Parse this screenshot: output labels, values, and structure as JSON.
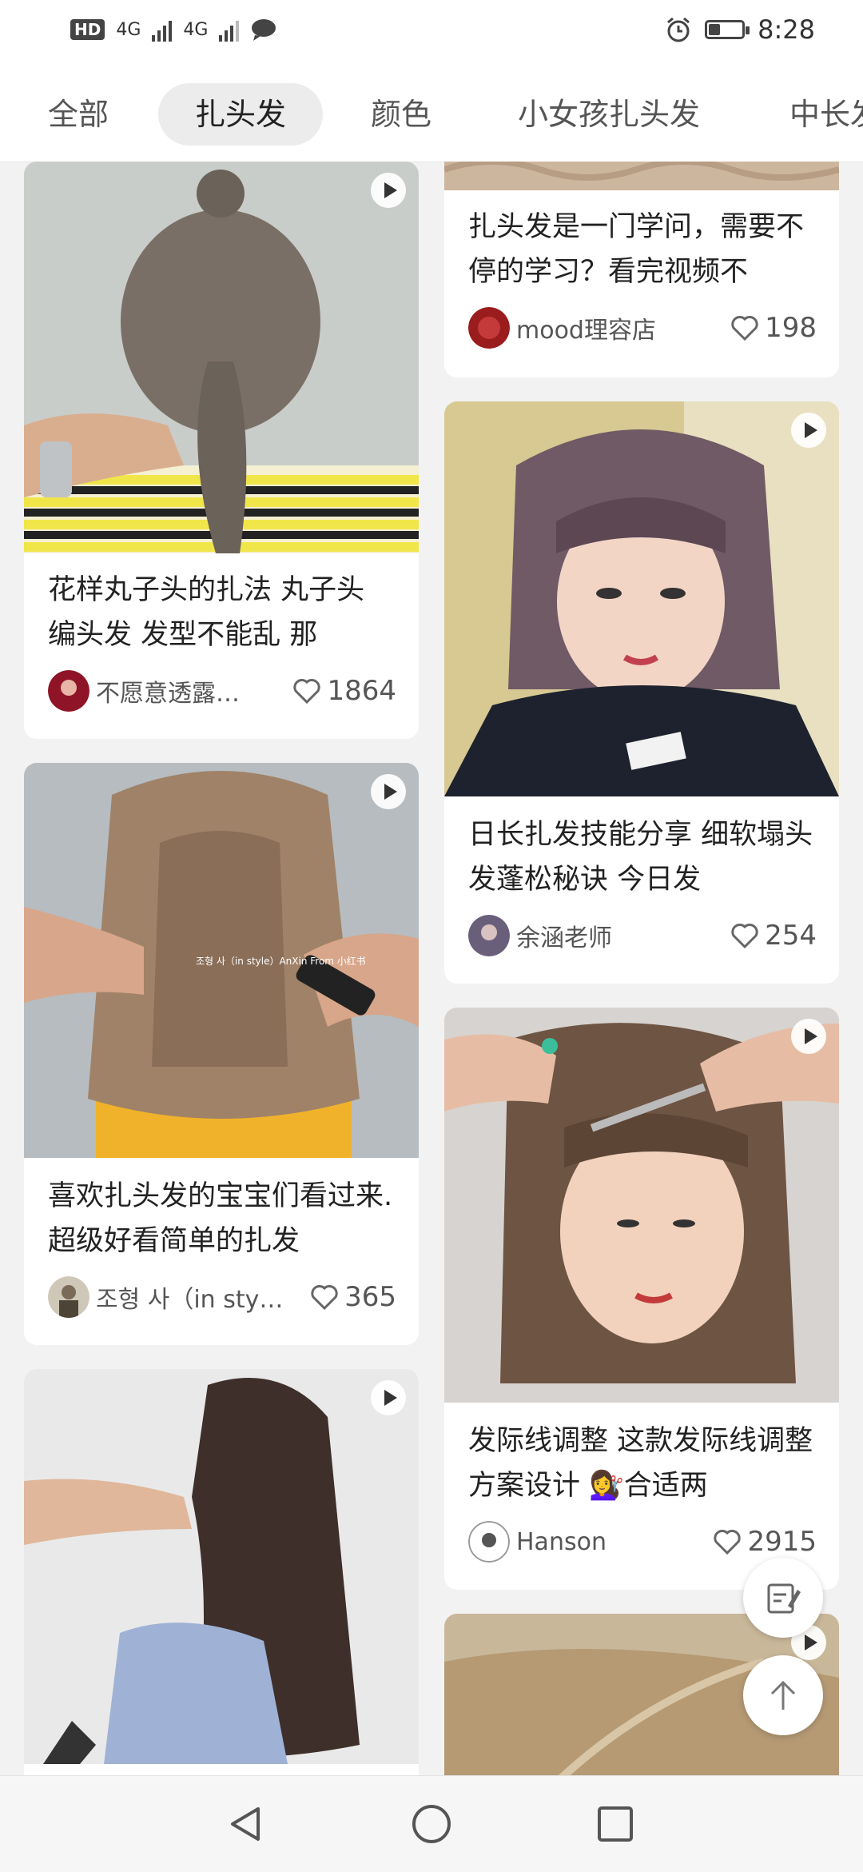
{
  "status_bar": {
    "hd_badge": "HD",
    "sim1": "4G",
    "sim2": "4G",
    "time": "8:28",
    "icons": [
      "signal-icon",
      "message-icon",
      "alarm-icon",
      "battery-icon"
    ],
    "battery_level": 0.35
  },
  "tabs": [
    {
      "label": "全部",
      "active": false
    },
    {
      "label": "扎头发",
      "active": true
    },
    {
      "label": "颜色",
      "active": false
    },
    {
      "label": "小女孩扎头发",
      "active": false
    },
    {
      "label": "中长发",
      "active": false
    }
  ],
  "cards_left": [
    {
      "title": "花样丸子头的扎法 丸子头 编头发 发型不能乱 那",
      "author": "不愿意透露…",
      "likes": "1864",
      "has_video": true
    },
    {
      "title": "喜欢扎头发的宝宝们看过来.超级好看简单的扎发",
      "author": "조형 사（in sty…",
      "likes": "365",
      "has_video": true,
      "image_watermark": "조형 사（in style）AnXin From 小红书"
    },
    {
      "title": "",
      "author": "",
      "likes": "",
      "has_video": true
    }
  ],
  "cards_right": [
    {
      "title": "扎头发是一门学问，需要不停的学习？看完视频不",
      "author": "mood理容店",
      "likes": "198"
    },
    {
      "title": "日长扎发技能分享 细软塌头发蓬松秘诀 今日发",
      "author": "余涵老师",
      "likes": "254",
      "has_video": true
    },
    {
      "title": "发际线调整 这款发际线调整方案设计 💇‍♀️合适两",
      "author": "Hanson",
      "likes": "2915",
      "has_video": true
    },
    {
      "title": "",
      "author": "",
      "likes": "",
      "has_video": true
    }
  ],
  "fab": {
    "edit_icon": "edit-note-icon",
    "top_icon": "arrow-up-icon"
  },
  "nav": [
    "back-icon",
    "home-icon",
    "recents-icon"
  ]
}
